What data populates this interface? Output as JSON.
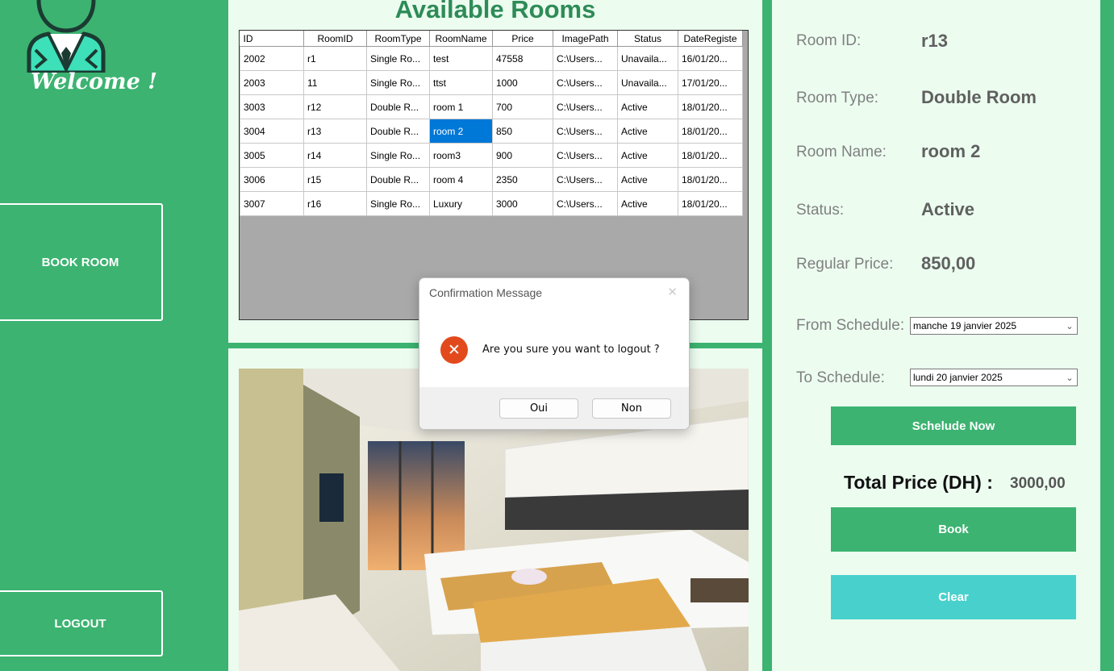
{
  "sidebar": {
    "welcome": "Welcome !",
    "book_room": "BOOK ROOM",
    "logout": "LOGOUT"
  },
  "rooms": {
    "title": "Available Rooms",
    "columns": [
      "ID",
      "RoomID",
      "RoomType",
      "RoomName",
      "Price",
      "ImagePath",
      "Status",
      "DateRegiste"
    ],
    "rows": [
      [
        "2002",
        "r1",
        "Single Ro...",
        "test",
        "47558",
        "C:\\Users...",
        "Unavaila...",
        "16/01/20..."
      ],
      [
        "2003",
        "11",
        "Single Ro...",
        "ttst",
        "1000",
        "C:\\Users...",
        "Unavaila...",
        "17/01/20..."
      ],
      [
        "3003",
        "r12",
        "Double R...",
        "room 1",
        "700",
        "C:\\Users...",
        "Active",
        "18/01/20..."
      ],
      [
        "3004",
        "r13",
        "Double R...",
        "room 2",
        "850",
        "C:\\Users...",
        "Active",
        "18/01/20..."
      ],
      [
        "3005",
        "r14",
        "Single Ro...",
        "room3",
        "900",
        "C:\\Users...",
        "Active",
        "18/01/20..."
      ],
      [
        "3006",
        "r15",
        "Double R...",
        "room 4",
        "2350",
        "C:\\Users...",
        "Active",
        "18/01/20..."
      ],
      [
        "3007",
        "r16",
        "Single Ro...",
        "Luxury",
        "3000",
        "C:\\Users...",
        "Active",
        "18/01/20..."
      ]
    ]
  },
  "details": {
    "room_id_label": "Room ID:",
    "room_id": "r13",
    "room_type_label": "Room Type:",
    "room_type": "Double Room",
    "room_name_label": "Room Name:",
    "room_name": "room 2",
    "status_label": "Status:",
    "status": "Active",
    "price_label": "Regular Price:",
    "price": "850,00",
    "from_label": "From Schedule:",
    "from_date": "manche 19   janvier   2025",
    "to_label": "To  Schedule:",
    "to_date": "lundi   20  janvier   2025",
    "schedule_btn": "Schelude Now",
    "total_label": "Total Price (DH) :",
    "total_value": "3000,00",
    "book_btn": "Book",
    "clear_btn": "Clear"
  },
  "dialog": {
    "title": "Confirmation Message",
    "close": "✕",
    "message": "Are you sure you want to logout ?",
    "yes": "Oui",
    "no": "Non",
    "icon": "error-icon"
  },
  "colors": {
    "green": "#3cb371",
    "cyan": "#48d1cc",
    "panel": "#ecfdf0",
    "selection": "#0078d7"
  }
}
